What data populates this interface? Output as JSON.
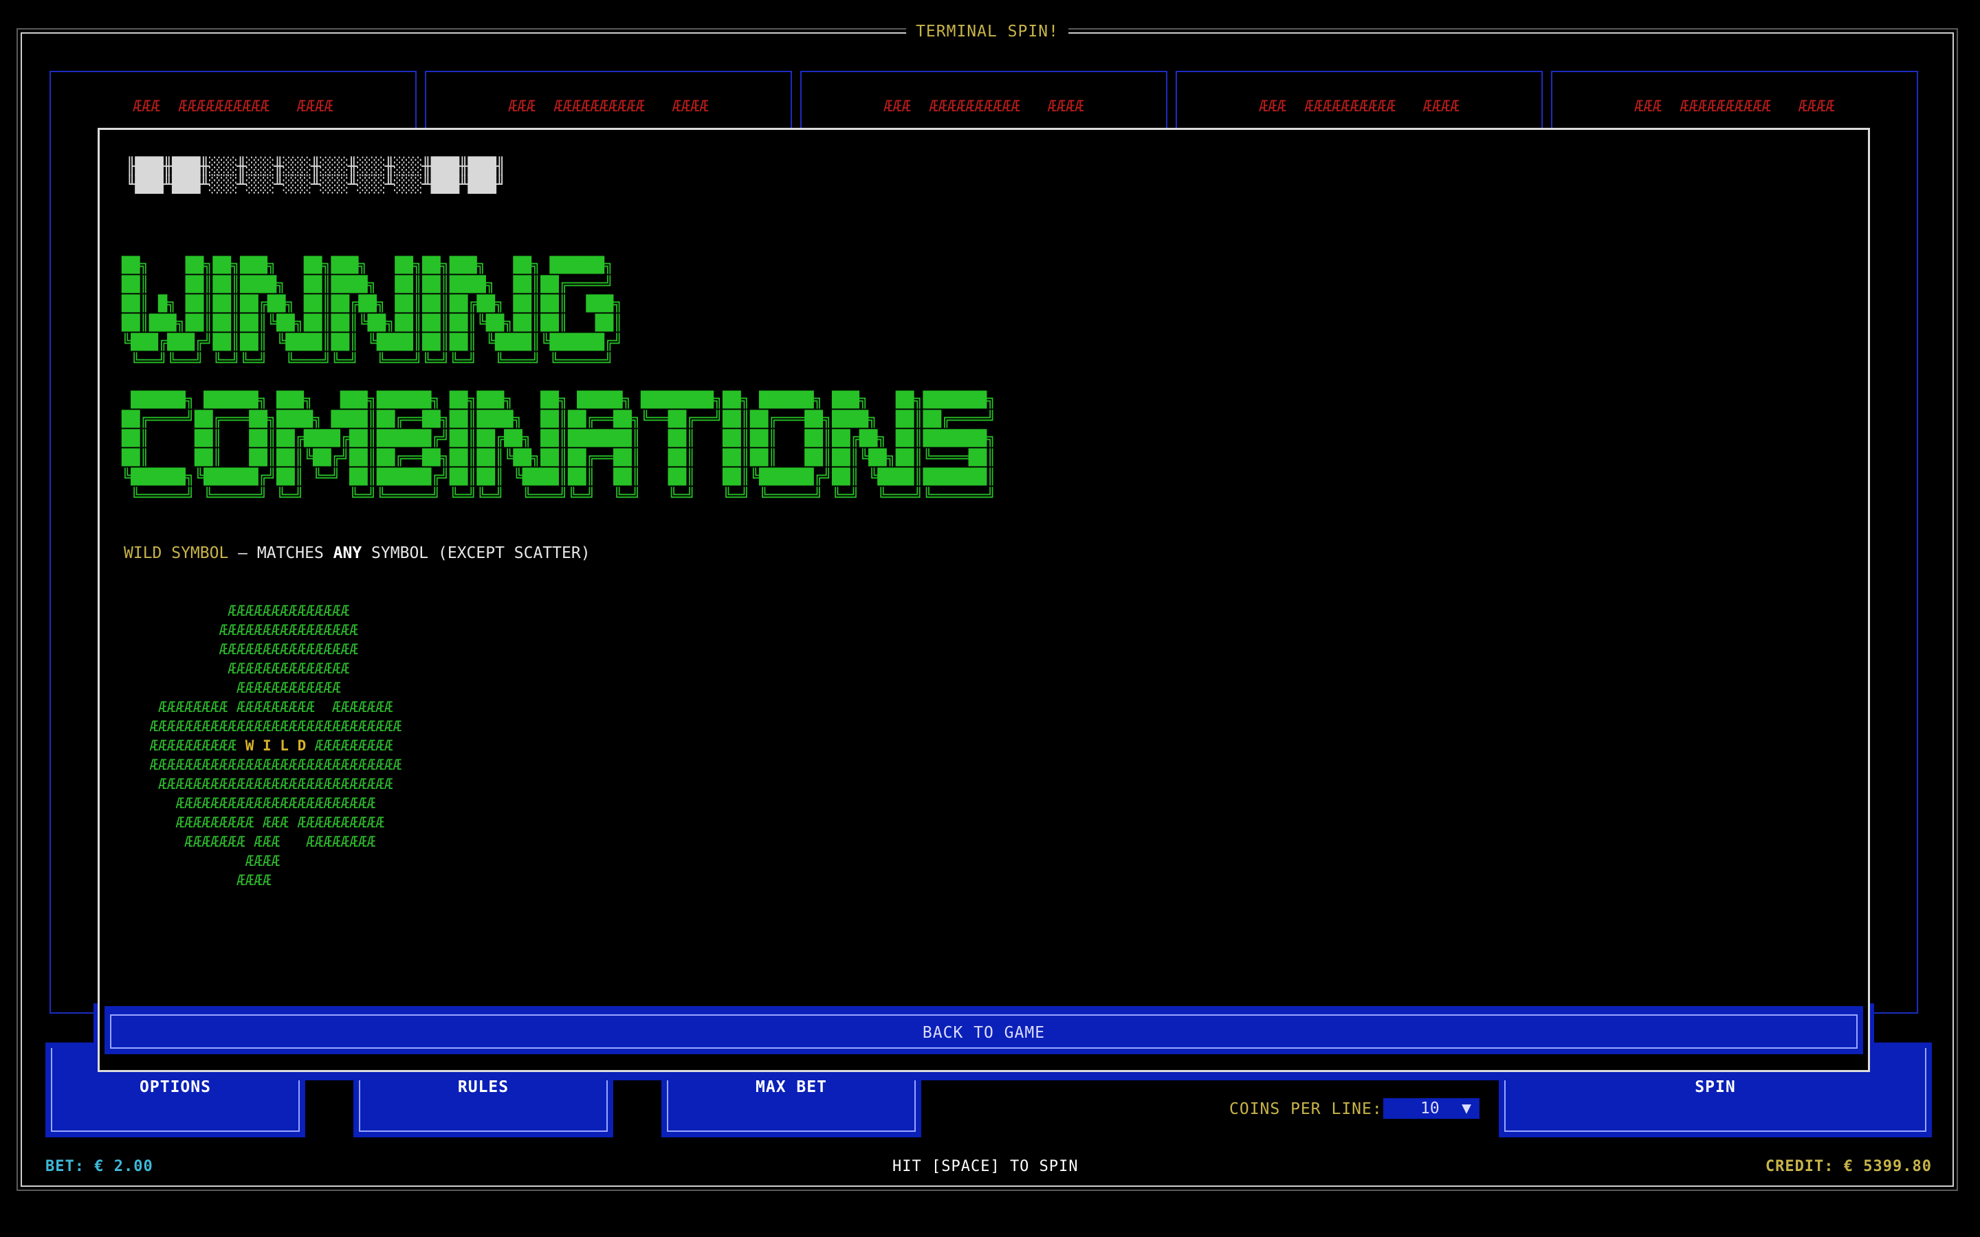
{
  "app": {
    "title": "TERMINAL SPIN!"
  },
  "reels": [
    {
      "top_symbol": "ÆÆÆ  ÆÆÆÆÆÆÆÆÆÆ   ÆÆÆÆ"
    },
    {
      "top_symbol": "ÆÆÆ  ÆÆÆÆÆÆÆÆÆÆ   ÆÆÆÆ"
    },
    {
      "top_symbol": "ÆÆÆ  ÆÆÆÆÆÆÆÆÆÆ   ÆÆÆÆ"
    },
    {
      "top_symbol": "ÆÆÆ  ÆÆÆÆÆÆÆÆÆÆ   ÆÆÆÆ"
    },
    {
      "top_symbol": "ÆÆÆ  ÆÆÆÆÆÆÆÆÆÆ   ÆÆÆÆ"
    }
  ],
  "modal": {
    "ascii_bar": "╟███╫███╫░░░╫░░░╫░░░╫░░░╫░░░╫░░░╫███╫███╢\n╙███╨███╨░░░╨░░░╨░░░╨░░░╨░░░╨░░░╨███╨███╜",
    "title_line1": "██╗    ██╗██╗███╗   ██╗███╗   ██╗██╗███╗   ██╗ ██████╗ \n██║    ██║██║████╗  ██║████╗  ██║██║████╗  ██║██╔════╝ \n██║ █╗ ██║██║██╔██╗ ██║██╔██╗ ██║██║██╔██╗ ██║██║  ███╗\n██║███╗██║██║██║╚██╗██║██║╚██╗██║██║██║╚██╗██║██║   ██║\n╚███╔███╔╝██║██║ ╚████║██║ ╚████║██║██║ ╚████║╚██████╔╝\n ╚══╝╚══╝ ╚═╝╚═╝  ╚═══╝╚═╝  ╚═══╝╚═╝╚═╝  ╚═══╝ ╚═════╝ ",
    "title_line2": " ██████╗ ██████╗ ███╗   ███╗██████╗ ██╗███╗   ██╗ █████╗ ████████╗██╗ ██████╗ ███╗   ██╗███████╗\n██╔════╝██╔═══██╗████╗ ████║██╔══██╗██║████╗  ██║██╔══██╗╚══██╔══╝██║██╔═══██╗████╗  ██║██╔════╝\n██║     ██║   ██║██╔████╔██║██████╔╝██║██╔██╗ ██║███████║   ██║   ██║██║   ██║██╔██╗ ██║███████╗\n██║     ██║   ██║██║╚██╔╝██║██╔══██╗██║██║╚██╗██║██╔══██║   ██║   ██║██║   ██║██║╚██╗██║╚════██║\n╚██████╗╚██████╔╝██║ ╚═╝ ██║██████╔╝██║██║ ╚████║██║  ██║   ██║   ██║╚██████╔╝██║ ╚████║███████║\n ╚═════╝ ╚═════╝ ╚═╝     ╚═╝╚═════╝ ╚═╝╚═╝  ╚═══╝╚═╝  ╚═╝   ╚═╝   ╚═╝ ╚═════╝ ╚═╝  ╚═══╝╚══════╝",
    "wild_symbol_label": "WILD SYMBOL",
    "wild_dash": " – MATCHES ",
    "wild_any": "ANY",
    "wild_rest": " SYMBOL (EXCEPT SCATTER)",
    "tree_top": "          ÆÆÆÆÆÆÆÆÆÆÆÆÆÆ\n         ÆÆÆÆÆÆÆÆÆÆÆÆÆÆÆÆ\n         ÆÆÆÆÆÆÆÆÆÆÆÆÆÆÆÆ\n          ÆÆÆÆÆÆÆÆÆÆÆÆÆÆ\n           ÆÆÆÆÆÆÆÆÆÆÆÆ\n  ÆÆÆÆÆÆÆÆ ÆÆÆÆÆÆÆÆÆ  ÆÆÆÆÆÆÆ\n ÆÆÆÆÆÆÆÆÆÆÆÆÆÆÆÆÆÆÆÆÆÆÆÆÆÆÆÆÆ\n ÆÆÆÆÆÆÆÆÆÆ ",
    "tree_wild": "W I L D",
    "tree_bottom": " ÆÆÆÆÆÆÆÆÆ\n ÆÆÆÆÆÆÆÆÆÆÆÆÆÆÆÆÆÆÆÆÆÆÆÆÆÆÆÆÆ\n  ÆÆÆÆÆÆÆÆÆÆÆÆÆÆÆÆÆÆÆÆÆÆÆÆÆÆÆ\n    ÆÆÆÆÆÆÆÆÆÆÆÆÆÆÆÆÆÆÆÆÆÆÆ\n    ÆÆÆÆÆÆÆÆÆ ÆÆÆ ÆÆÆÆÆÆÆÆÆÆ\n     ÆÆÆÆÆÆÆ ÆÆÆ   ÆÆÆÆÆÆÆÆ\n            ÆÆÆÆ\n           ÆÆÆÆ",
    "back_label": "BACK TO GAME"
  },
  "controls": {
    "options_label": "OPTIONS",
    "rules_label": "RULES",
    "max_bet_label": "MAX BET",
    "coins_label": "COINS PER LINE:",
    "coins_value": "10",
    "coins_caret": "▼",
    "spin_label": "SPIN"
  },
  "status": {
    "bet": "BET: € 2.00",
    "hint": "HIT [SPACE] TO SPIN",
    "credit": "CREDIT: € 5399.80"
  },
  "colors": {
    "accent_blue": "#0a20b8",
    "reel_border": "#1c2cc0",
    "title_gold": "#c8b44a",
    "symbol_red": "#b81c1c",
    "banner_green": "#27c227",
    "bet_cyan": "#3fb8d8"
  }
}
